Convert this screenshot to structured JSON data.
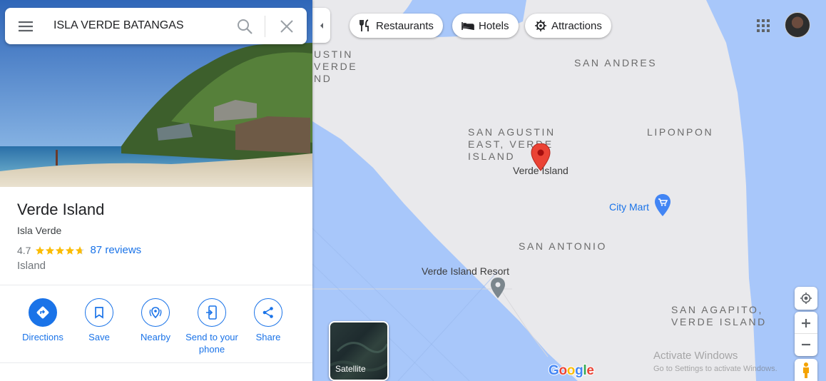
{
  "search": {
    "query": "ISLA VERDE BATANGAS"
  },
  "place": {
    "title": "Verde Island",
    "subtitle": "Isla Verde",
    "rating": "4.7",
    "rating_stars": 4.7,
    "reviews": "87 reviews",
    "category": "Island"
  },
  "actions": [
    {
      "label": "Directions",
      "icon": "directions-icon"
    },
    {
      "label": "Save",
      "icon": "bookmark-icon"
    },
    {
      "label": "Nearby",
      "icon": "nearby-icon"
    },
    {
      "label": "Send to your phone",
      "icon": "send-to-phone-icon"
    },
    {
      "label": "Share",
      "icon": "share-icon"
    }
  ],
  "chips": [
    {
      "label": "Restaurants",
      "icon": "fork-knife-icon"
    },
    {
      "label": "Hotels",
      "icon": "bed-icon"
    },
    {
      "label": "Attractions",
      "icon": "attractions-icon"
    }
  ],
  "map": {
    "labels": {
      "san_agustin_west": "USTIN\nVERDE\nND",
      "san_andres": "SAN ANDRES",
      "san_agustin_east": "SAN AGUSTIN\nEAST, VERDE\nISLAND",
      "liponpon": "LIPONPON",
      "san_antonio": "SAN ANTONIO",
      "san_agapito": "SAN AGAPITO,\nVERDE ISLAND"
    },
    "pins": {
      "verde_island": "Verde Island",
      "city_mart": "City Mart",
      "resort": "Verde Island Resort"
    },
    "satellite_label": "Satellite",
    "logo": "Google",
    "watermark_title": "Activate Windows",
    "watermark_sub": "Go to Settings to activate Windows."
  },
  "colors": {
    "accent": "#1a73e8",
    "water": "#a8c7fa",
    "land": "#e9e9ec",
    "pin": "#ea4335",
    "star": "#fbbc04"
  }
}
